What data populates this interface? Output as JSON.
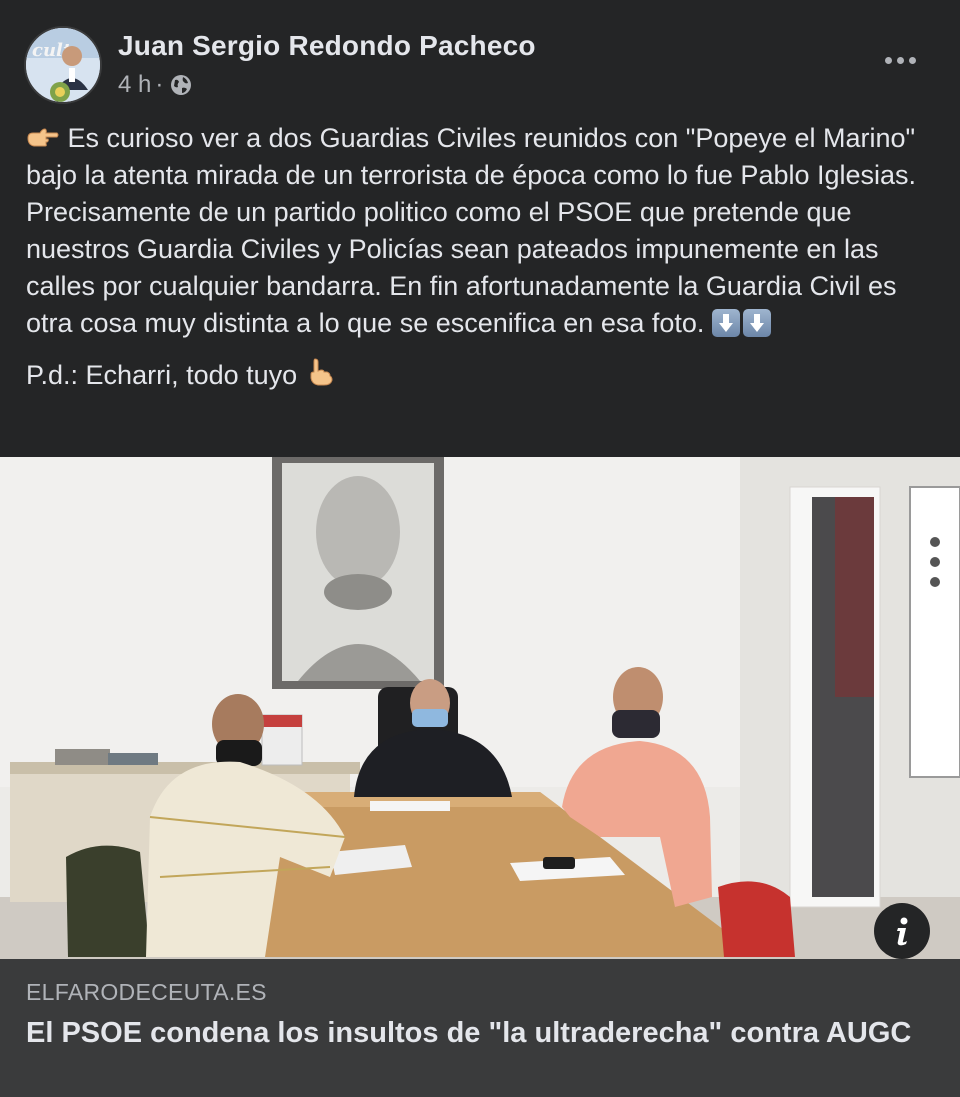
{
  "post": {
    "author": "Juan Sergio Redondo Pacheco",
    "time": "4 h",
    "separator": "·",
    "privacy_icon": "globe-icon",
    "body": {
      "line1": "Es curioso ver a dos Guardias Civiles reunidos con \"Popeye el Marino\" bajo la atenta mirada de un terrorista de época como lo fue Pablo Iglesias. Precisamente de un partido politico como el PSOE que pretende que nuestros Guardia Civiles y Policías sean pateados impunemente en las calles por cualquier bandarra. En fin afortunadamente la Guardia Civil es otra cosa muy distinta a lo que se escenifica en esa foto.",
      "pd": "P.d.: Echarri, todo tuyo"
    },
    "icons": [
      "pointing-right-emoji",
      "down-arrow-emoji",
      "down-arrow-emoji",
      "pointing-down-emoji",
      "more-icon",
      "info-icon"
    ]
  },
  "link_preview": {
    "domain": "ELFARODECEUTA.ES",
    "headline": "El PSOE condena los insultos de \"la ultraderecha\" contra AUGC"
  },
  "colors": {
    "background": "#242526",
    "preview_bg": "#3a3b3c",
    "text_primary": "#e4e6eb",
    "text_secondary": "#b0b3b8"
  }
}
